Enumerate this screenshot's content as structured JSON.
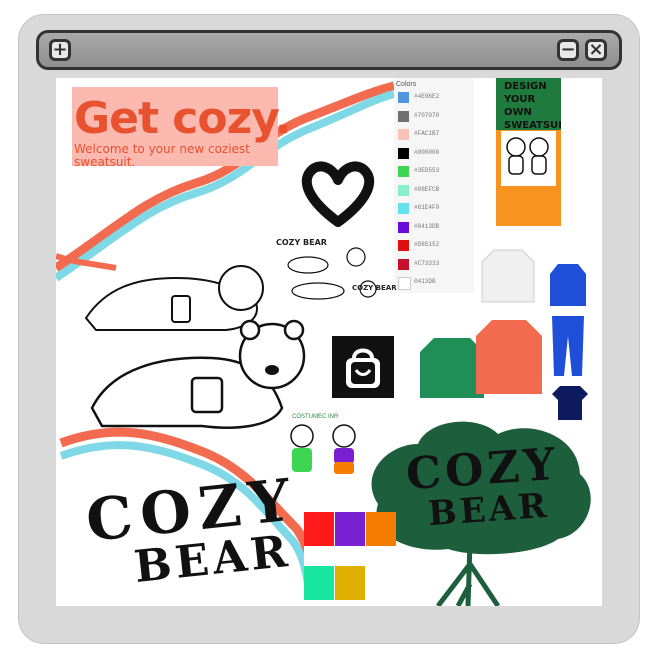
{
  "window": {
    "left_button_icon": "+",
    "minimize_icon": "−",
    "close_icon": "×"
  },
  "ad": {
    "title": "Get cozy.",
    "subtitle": "Welcome to your new coziest sweatsuit.",
    "background": "#fbb9b0",
    "text_color": "#e8522e"
  },
  "swatch_panel": {
    "header": "Colors",
    "items": [
      {
        "hex": "#4E96E2",
        "color": "#4e96e2"
      },
      {
        "hex": "#707070",
        "color": "#707070"
      },
      {
        "hex": "#FAC1B7",
        "color": "#fac1b7"
      },
      {
        "hex": "#000000",
        "color": "#000000"
      },
      {
        "hex": "#3ED553",
        "color": "#3ed553"
      },
      {
        "hex": "#88EFCB",
        "color": "#88efcb"
      },
      {
        "hex": "#61E4F0",
        "color": "#61e4f0"
      },
      {
        "hex": "#0413DB",
        "color": "#6a0bdb"
      },
      {
        "hex": "#D85152",
        "color": "#e01010"
      },
      {
        "hex": "#C73333",
        "color": "#c8102e"
      },
      {
        "hex": "0413DB",
        "color": "#ffffff"
      }
    ]
  },
  "poster": {
    "text": "DESIGN YOUR OWN SWEATSUIT"
  },
  "stickers": {
    "cozy_small": "COZY BEAR",
    "cozy_small2": "COZY BEAR",
    "costume_label": "COSTUMEC INR"
  },
  "logo_left": {
    "line1": "COZY",
    "line2": "BEAR"
  },
  "logo_tree": {
    "line1": "COZY",
    "line2": "BEAR"
  },
  "palette_card": {
    "colors": [
      "#ff1a1a",
      "#7a1fd1",
      "#f57c00",
      "#18e6a0",
      "#e0b000"
    ]
  }
}
